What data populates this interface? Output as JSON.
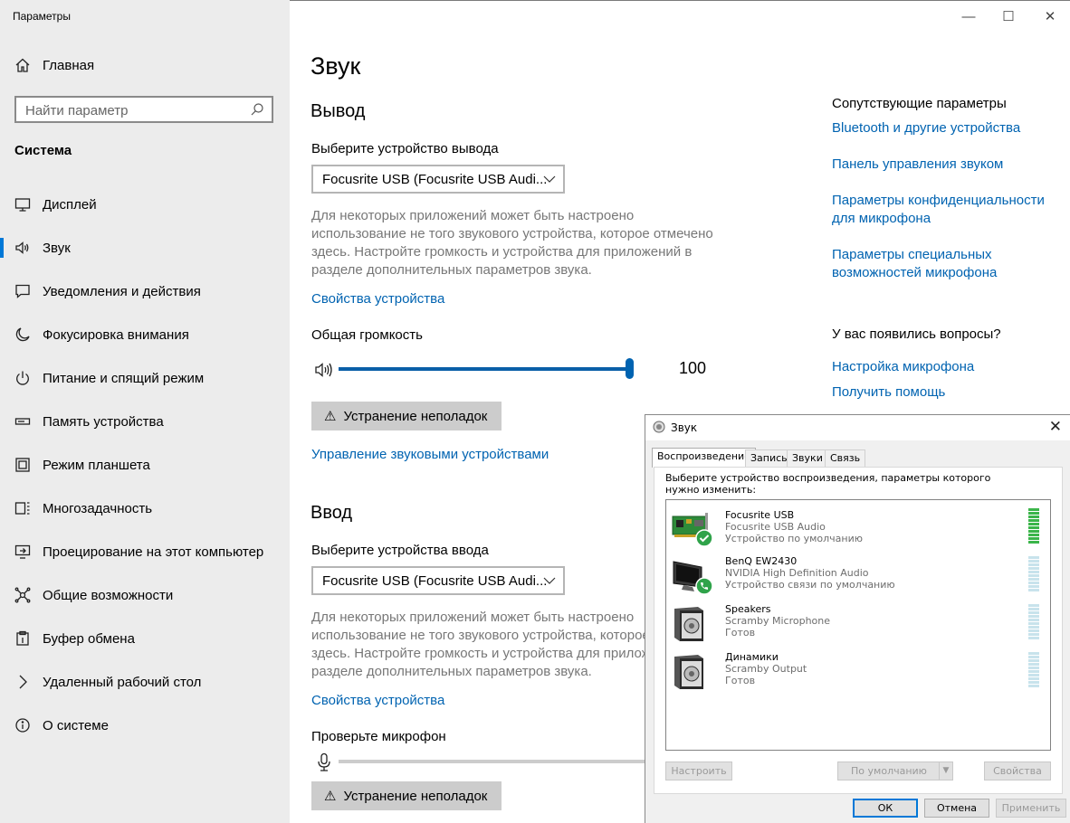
{
  "window": {
    "title": "Параметры",
    "minimize": "—",
    "maximize": "☐",
    "close": "✕"
  },
  "sidebar": {
    "home": "Главная",
    "search_placeholder": "Найти параметр",
    "section": "Система",
    "items": [
      {
        "label": "Дисплей",
        "icon": "display-icon"
      },
      {
        "label": "Звук",
        "icon": "speaker-icon",
        "selected": true
      },
      {
        "label": "Уведомления и действия",
        "icon": "notifications-icon"
      },
      {
        "label": "Фокусировка внимания",
        "icon": "moon-icon"
      },
      {
        "label": "Питание и спящий режим",
        "icon": "power-icon"
      },
      {
        "label": "Память устройства",
        "icon": "storage-icon"
      },
      {
        "label": "Режим планшета",
        "icon": "tablet-icon"
      },
      {
        "label": "Многозадачность",
        "icon": "multitasking-icon"
      },
      {
        "label": "Проецирование на этот компьютер",
        "icon": "projecting-icon"
      },
      {
        "label": "Общие возможности",
        "icon": "shared-experiences-icon"
      },
      {
        "label": "Буфер обмена",
        "icon": "clipboard-icon"
      },
      {
        "label": "Удаленный рабочий стол",
        "icon": "remote-desktop-icon"
      },
      {
        "label": "О системе",
        "icon": "info-icon"
      }
    ]
  },
  "main": {
    "title": "Звук",
    "output": {
      "heading": "Вывод",
      "select_label": "Выберите устройство вывода",
      "device": "Focusrite USB (Focusrite USB Audi...",
      "desc": "Для некоторых приложений может быть настроено использование не того звукового устройства, которое отмечено здесь. Настройте громкость и устройства для приложений в разделе дополнительных параметров звука.",
      "properties_link": "Свойства устройства",
      "volume_label": "Общая громкость",
      "volume": 100,
      "volume_text": "100",
      "troubleshoot": "Устранение неполадок",
      "manage_link": "Управление звуковыми устройствами"
    },
    "input": {
      "heading": "Ввод",
      "select_label": "Выберите устройства ввода",
      "device": "Focusrite USB (Focusrite USB Audi...",
      "desc": "Для некоторых приложений может быть настроено использование не того звукового устройства, которое отмечено здесь. Настройте громкость и устройства для приложений в разделе дополнительных параметров звука.",
      "properties_link": "Свойства устройства",
      "mic_test_label": "Проверьте микрофон",
      "troubleshoot": "Устранение неполадок"
    }
  },
  "related": {
    "heading": "Сопутствующие параметры",
    "links": [
      "Bluetooth и другие устройства",
      "Панель управления звуком",
      "Параметры конфиденциальности для микрофона",
      "Параметры специальных возможностей микрофона"
    ],
    "questions_heading": "У вас появились вопросы?",
    "help_links": [
      "Настройка микрофона",
      "Получить помощь"
    ]
  },
  "sound_dialog": {
    "title": "Звук",
    "close": "✕",
    "tabs": [
      "Воспроизведение",
      "Запись",
      "Звуки",
      "Связь"
    ],
    "selected_tab": 0,
    "description": "Выберите устройство воспроизведения, параметры которого нужно изменить:",
    "devices": [
      {
        "name": "Focusrite USB",
        "driver": "Focusrite USB Audio",
        "status": "Устройство по умолчанию",
        "icon": "sound-card-icon",
        "badge": "default-check-icon",
        "level": 1.0
      },
      {
        "name": "BenQ EW2430",
        "driver": "NVIDIA High Definition Audio",
        "status": "Устройство связи по умолчанию",
        "icon": "monitor-icon",
        "badge": "phone-badge-icon",
        "level": 0
      },
      {
        "name": "Speakers",
        "driver": "Scramby Microphone",
        "status": "Готов",
        "icon": "speaker-device-icon",
        "level": 0
      },
      {
        "name": "Динамики",
        "driver": "Scramby Output",
        "status": "Готов",
        "icon": "speaker-device-icon",
        "level": 0
      }
    ],
    "buttons": {
      "configure": "Настроить",
      "default": "По умолчанию",
      "properties": "Свойства",
      "ok": "ОК",
      "cancel": "Отмена",
      "apply": "Применить"
    },
    "meter_colors": {
      "active": "#3bb54a",
      "inactive": "#c8e3ec"
    }
  }
}
